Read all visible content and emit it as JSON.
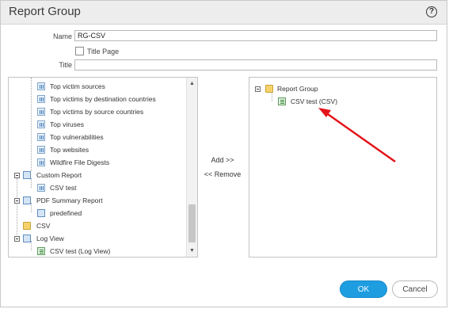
{
  "dialog": {
    "title": "Report Group"
  },
  "form": {
    "name_label": "Name",
    "name_value": "RG-CSV",
    "title_page_label": "Title Page",
    "title_label": "Title",
    "title_value": ""
  },
  "left_tree": {
    "items": [
      {
        "label": "Top victim sources"
      },
      {
        "label": "Top victims by destination countries"
      },
      {
        "label": "Top victims by source countries"
      },
      {
        "label": "Top viruses"
      },
      {
        "label": "Top vulnerabilities"
      },
      {
        "label": "Top websites"
      },
      {
        "label": "Wildfire File Digests"
      },
      {
        "label": "Custom Report"
      },
      {
        "label": "CSV test"
      },
      {
        "label": "PDF Summary Report"
      },
      {
        "label": "predefined"
      },
      {
        "label": "CSV"
      },
      {
        "label": "Log View"
      },
      {
        "label": "CSV test (Log View)"
      }
    ]
  },
  "actions": {
    "add_label": "Add >>",
    "remove_label": "<< Remove"
  },
  "right_tree": {
    "group_label": "Report Group",
    "child_label": "CSV test (CSV)"
  },
  "buttons": {
    "ok_label": "OK",
    "cancel_label": "Cancel"
  },
  "colors": {
    "ok_blue": "#1e9de1",
    "arrow_red": "#e3141a"
  }
}
